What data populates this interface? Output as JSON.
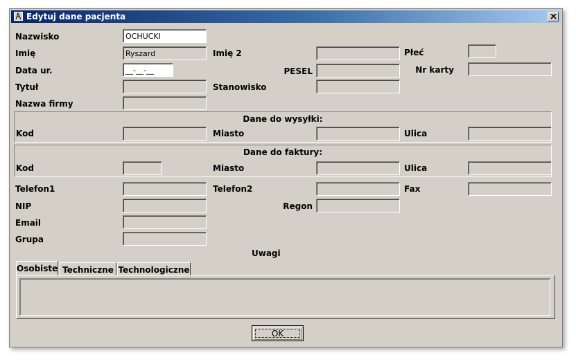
{
  "window": {
    "title": "Edytuj dane pacjenta"
  },
  "labels": {
    "nazwisko": "Nazwisko",
    "imie": "Imię",
    "imie2": "Imię 2",
    "plec": "Płeć",
    "data_ur": "Data ur.",
    "pesel": "PESEL",
    "nr_karty": "Nr karty",
    "tytul": "Tytuł",
    "stanowisko": "Stanowisko",
    "nazwa_firmy": "Nazwa firmy",
    "telefon1": "Telefon1",
    "telefon2": "Telefon2",
    "fax": "Fax",
    "nip": "NIP",
    "regon": "Regon",
    "email": "Email",
    "grupa": "Grupa",
    "uwagi": "Uwagi"
  },
  "values": {
    "nazwisko": "OCHUCKI",
    "imie": "Ryszard",
    "data_ur": "__-__-__"
  },
  "shipping": {
    "title": "Dane do wysyłki:",
    "kod": "Kod",
    "miasto": "Miasto",
    "ulica": "Ulica"
  },
  "invoice": {
    "title": "Dane do faktury:",
    "kod": "Kod",
    "miasto": "Miasto",
    "ulica": "Ulica"
  },
  "tabs": [
    "Osobiste",
    "Techniczne",
    "Technologiczne"
  ],
  "buttons": {
    "ok": "OK"
  }
}
